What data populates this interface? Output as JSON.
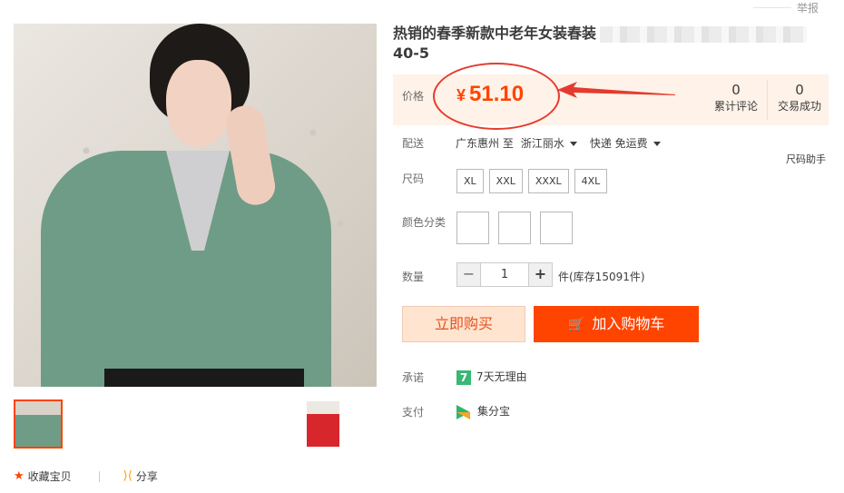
{
  "report_label": "举报",
  "title_line1": "热销的春季新款中老年女装春装",
  "title_line2": "40-5",
  "price": {
    "label": "价格",
    "currency": "¥",
    "value": "51.10"
  },
  "stats": [
    {
      "count": "0",
      "label": "累计评论"
    },
    {
      "count": "0",
      "label": "交易成功"
    }
  ],
  "delivery": {
    "label": "配送",
    "from": "广东惠州 至",
    "to": "浙江丽水",
    "shipping": "快递 免运费"
  },
  "size_helper": "尺码助手",
  "size": {
    "label": "尺码",
    "options": [
      "XL",
      "XXL",
      "XXXL",
      "4XL"
    ]
  },
  "color": {
    "label": "颜色分类"
  },
  "quantity": {
    "label": "数量",
    "minus": "−",
    "value": "1",
    "plus": "+",
    "stock": "件(库存15091件)"
  },
  "buttons": {
    "buy_now": "立即购买",
    "add_to_cart": "加入购物车"
  },
  "promise": {
    "label": "承诺",
    "icon_text": "7",
    "value": "7天无理由"
  },
  "payment": {
    "label": "支付",
    "value": "集分宝"
  },
  "actions": {
    "favorite": "收藏宝贝",
    "share": "分享"
  },
  "colors": {
    "accent": "#ff4400",
    "annotation": "#e43b2f",
    "price_bg": "#fff2e8"
  }
}
